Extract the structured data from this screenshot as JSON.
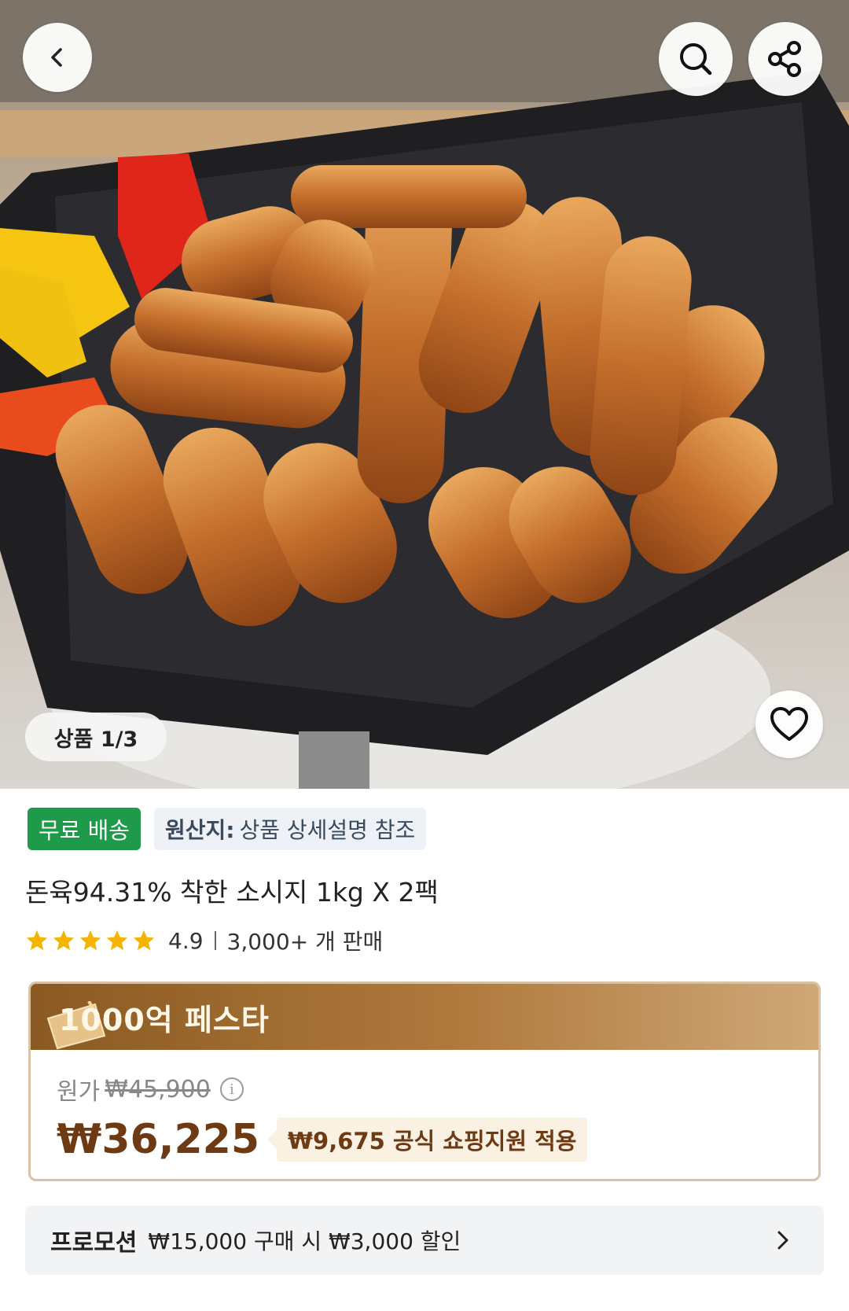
{
  "hero": {
    "image_alt": "돈육 소시지",
    "counter_label": "상품 1/3"
  },
  "nav": {
    "back_icon": "chevron-left-icon",
    "search_icon": "search-icon",
    "share_icon": "share-icon",
    "favorite_icon": "heart-icon"
  },
  "badges": {
    "free_shipping": "무료 배송",
    "origin_key": "원산지:",
    "origin_value": "상품 상세설명 참조"
  },
  "product": {
    "title": "돈육94.31% 착한 소시지 1kg X 2팩",
    "rating": "4.9",
    "sold": "3,000+ 개 판매",
    "stars": 5
  },
  "price_card": {
    "festival_title": "1000억 페스타",
    "original_label": "원가",
    "original_price": "₩45,900",
    "sale_price": "₩36,225",
    "support_text": "₩9,675 공식 쇼핑지원 적용"
  },
  "promotion": {
    "label": "프로모션",
    "text": "₩15,000 구매 시 ₩3,000 할인"
  },
  "colors": {
    "free_shipping_bg": "#1f9a4a",
    "price_brown": "#6d3a14",
    "star": "#f5b400"
  }
}
